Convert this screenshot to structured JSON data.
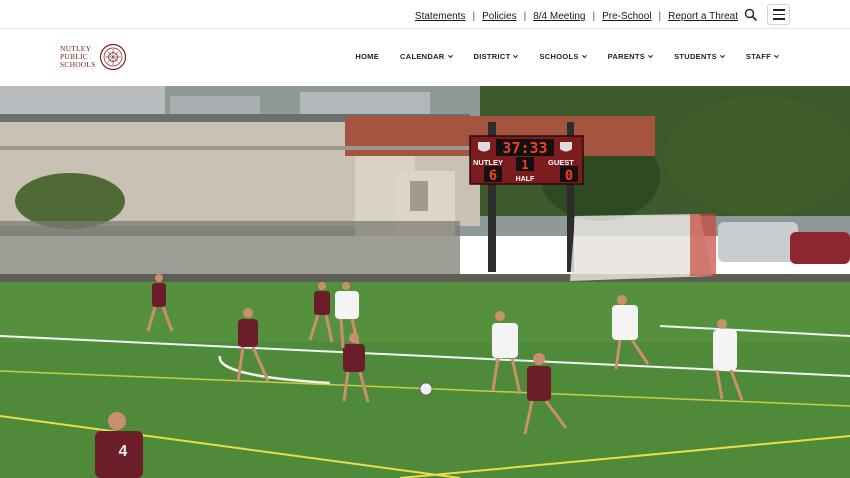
{
  "utility": {
    "links": [
      "Statements",
      "Policies",
      "8/4 Meeting",
      "Pre-School",
      "Report a Threat"
    ],
    "icons": {
      "search": "search-icon",
      "menu": "hamburger-menu-icon"
    }
  },
  "logo": {
    "line1": "NUTLEY",
    "line2": "PUBLIC",
    "line3": "SCHOOLS",
    "color": "#7a2222"
  },
  "nav": {
    "items": [
      "HOME",
      "CALENDAR",
      "DISTRICT",
      "SCHOOLS",
      "PARENTS",
      "STUDENTS",
      "STAFF"
    ],
    "has_dropdown": [
      false,
      true,
      true,
      true,
      true,
      true,
      true
    ]
  },
  "hero": {
    "scoreboard": {
      "clock": "37:33",
      "home_label": "NUTLEY",
      "guest_label": "GUEST",
      "home_score": "6",
      "period": "1",
      "period_label": "HALF",
      "guest_score": "0"
    },
    "player_jersey": "4"
  }
}
